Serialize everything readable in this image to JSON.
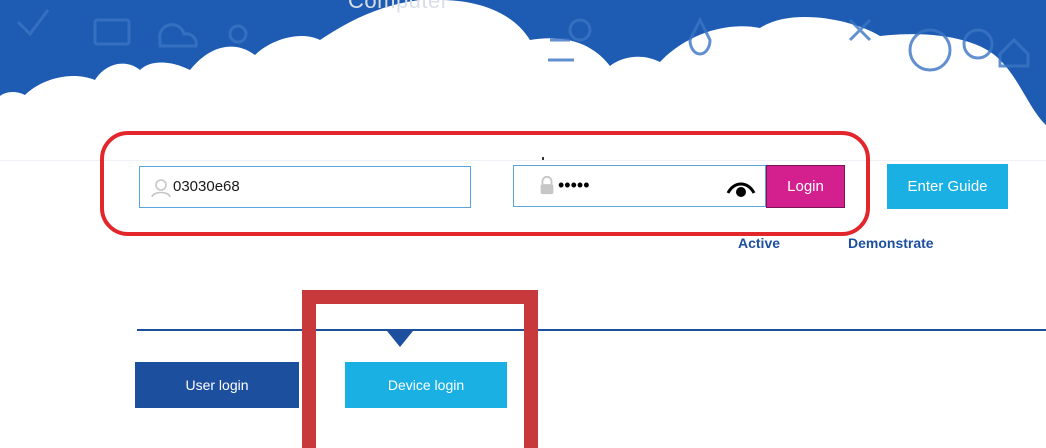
{
  "banner": {
    "title": "Computer"
  },
  "login": {
    "username_value": "03030e68",
    "password_mask": "•••••",
    "login_label": "Login",
    "guide_label": "Enter Guide"
  },
  "links": {
    "active": "Active",
    "demonstrate": "Demonstrate"
  },
  "tabs": [
    {
      "label": "User login",
      "selected": false
    },
    {
      "label": "Device login",
      "selected": true
    }
  ],
  "icons": [
    "user-icon",
    "lock-icon",
    "eye-icon",
    "tab-pointer-icon"
  ],
  "colors": {
    "brand_blue": "#1d4f9f",
    "light_blue": "#1ab0e4",
    "login_magenta": "#d41f8f",
    "highlight_red": "#e3262c",
    "highlight_dark_red": "#c7393a"
  }
}
